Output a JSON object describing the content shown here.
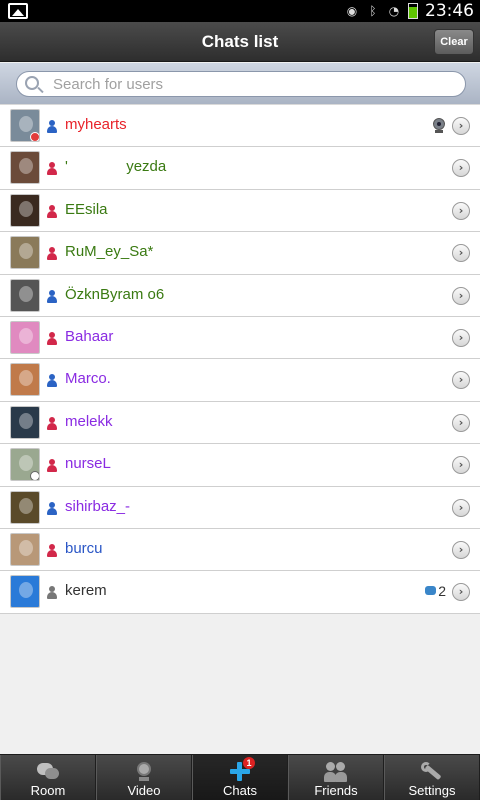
{
  "statusbar": {
    "time": "23:46",
    "icons": [
      "gallery-notification-icon",
      "eye-icon",
      "bluetooth-icon",
      "wifi-icon",
      "battery-icon"
    ]
  },
  "header": {
    "title": "Chats list",
    "clear_label": "Clear"
  },
  "search": {
    "placeholder": "Search for users",
    "value": ""
  },
  "colors": {
    "red_name": "#e8232a",
    "green_name": "#3a7a12",
    "purple_name": "#8a2be2",
    "blue_name": "#2a56c6",
    "gray_name": "#333333",
    "tab_active_icon": "#2aa6e8"
  },
  "chats": [
    {
      "name": "myhearts",
      "color": "#e8232a",
      "gender": "male",
      "avatar": "#7a8b9a",
      "badge": "red",
      "extra": "webcam-icon"
    },
    {
      "name": "'              yezda",
      "color": "#3a7a12",
      "gender": "female",
      "avatar": "#6b4b3a",
      "badge": "",
      "extra": ""
    },
    {
      "name": "EEsila",
      "color": "#3a7a12",
      "gender": "female",
      "avatar": "#3a2a20",
      "badge": "",
      "extra": ""
    },
    {
      "name": "RuM_ey_Sa*",
      "color": "#3a7a12",
      "gender": "female",
      "avatar": "#8a7a5a",
      "badge": "",
      "extra": ""
    },
    {
      "name": "ÖzknByram o6",
      "color": "#3a7a12",
      "gender": "male",
      "avatar": "#555555",
      "badge": "",
      "extra": ""
    },
    {
      "name": "Bahaar",
      "color": "#8a2be2",
      "gender": "female",
      "avatar": "#e08ac0",
      "badge": "",
      "extra": ""
    },
    {
      "name": "Marco.",
      "color": "#8a2be2",
      "gender": "male",
      "avatar": "#c07a4a",
      "badge": "",
      "extra": ""
    },
    {
      "name": "melekk",
      "color": "#8a2be2",
      "gender": "female",
      "avatar": "#2a3a4a",
      "badge": "",
      "extra": ""
    },
    {
      "name": "nurseL",
      "color": "#8a2be2",
      "gender": "female",
      "avatar": "#9aa890",
      "badge": "clock",
      "extra": ""
    },
    {
      "name": "sihirbaz_-",
      "color": "#8a2be2",
      "gender": "male",
      "avatar": "#5a4a2a",
      "badge": "",
      "extra": ""
    },
    {
      "name": "burcu",
      "color": "#2a56c6",
      "gender": "female",
      "avatar": "#b89878",
      "badge": "",
      "extra": ""
    },
    {
      "name": "kerem",
      "color": "#333333",
      "gender": "unknown",
      "avatar": "#2a7ad8",
      "badge": "",
      "extra": "messages",
      "messages": "2"
    }
  ],
  "tabs": [
    {
      "label": "Room",
      "icon": "chat-bubbles-icon",
      "active": false
    },
    {
      "label": "Video",
      "icon": "webcam-icon",
      "active": false
    },
    {
      "label": "Chats",
      "icon": "plus-icon",
      "active": true,
      "badge": "1"
    },
    {
      "label": "Friends",
      "icon": "friends-icon",
      "active": false
    },
    {
      "label": "Settings",
      "icon": "wrench-icon",
      "active": false
    }
  ]
}
